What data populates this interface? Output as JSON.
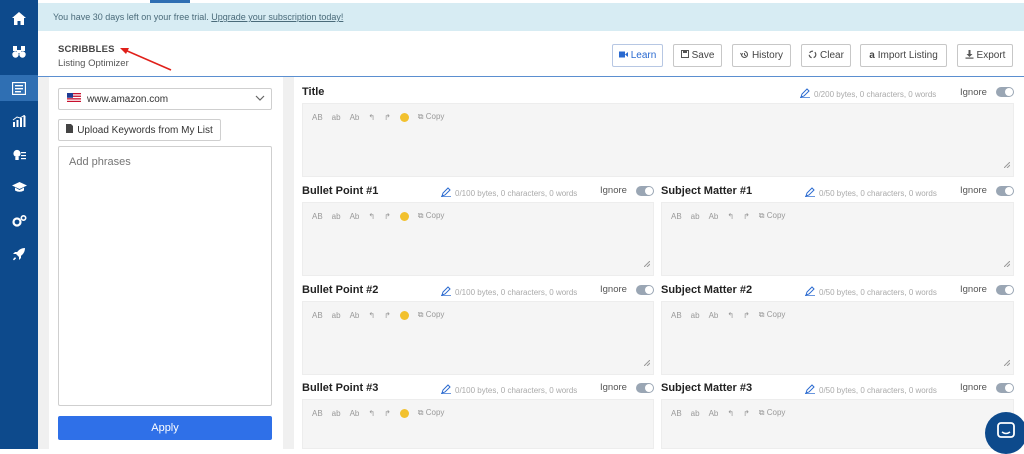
{
  "sidebar": {
    "items": [
      {
        "icon": "home-icon"
      },
      {
        "icon": "binoculars-icon"
      },
      {
        "icon": "listing-icon"
      },
      {
        "icon": "chart-icon"
      },
      {
        "icon": "lightbulb-icon"
      },
      {
        "icon": "graduation-cap-icon"
      },
      {
        "icon": "gears-icon"
      },
      {
        "icon": "rocket-icon"
      }
    ]
  },
  "banner": {
    "text": "You have 30 days left on your free trial.",
    "link": "Upgrade your subscription today!"
  },
  "header": {
    "title": "SCRIBBLES",
    "subtitle": "Listing Optimizer"
  },
  "toolbar": {
    "learn": "Learn",
    "save": "Save",
    "history": "History",
    "clear": "Clear",
    "import": "Import Listing",
    "export": "Export"
  },
  "left": {
    "marketplace": "www.amazon.com",
    "upload": "Upload Keywords from My List",
    "phrases_placeholder": "Add phrases",
    "apply": "Apply"
  },
  "editor_tools": {
    "upper": "AB",
    "lower": "ab",
    "title_case": "Ab",
    "copy": "Copy"
  },
  "ignore_label": "Ignore",
  "fields": {
    "title": {
      "label": "Title",
      "meta": "0/200 bytes, 0 characters, 0 words"
    },
    "bullet1": {
      "label": "Bullet Point #1",
      "meta": "0/100 bytes, 0 characters, 0 words"
    },
    "bullet2": {
      "label": "Bullet Point #2",
      "meta": "0/100 bytes, 0 characters, 0 words"
    },
    "bullet3": {
      "label": "Bullet Point #3",
      "meta": "0/100 bytes, 0 characters, 0 words"
    },
    "subject1": {
      "label": "Subject Matter #1",
      "meta": "0/50 bytes, 0 characters, 0 words"
    },
    "subject2": {
      "label": "Subject Matter #2",
      "meta": "0/50 bytes, 0 characters, 0 words"
    },
    "subject3": {
      "label": "Subject Matter #3",
      "meta": "0/50 bytes, 0 characters, 0 words"
    }
  }
}
